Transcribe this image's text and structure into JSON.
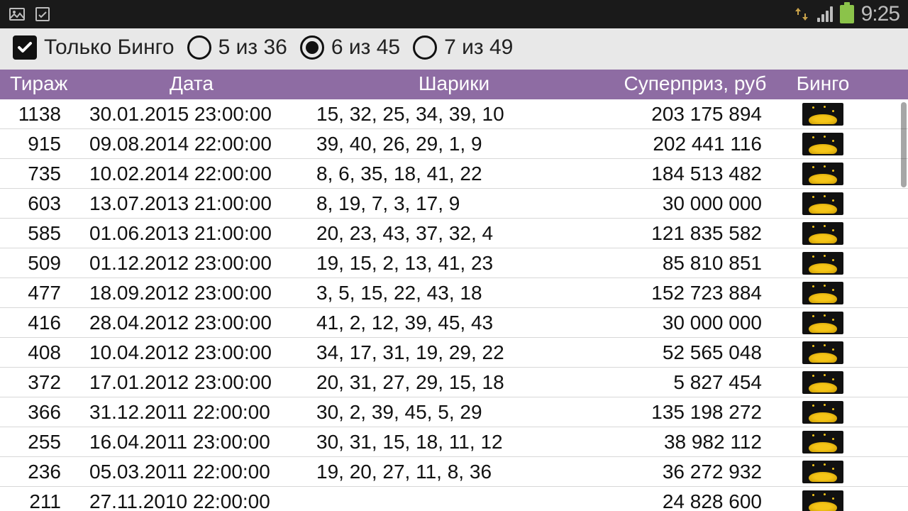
{
  "statusbar": {
    "clock": "9:25"
  },
  "filter": {
    "bingo_only_label": "Только Бинго",
    "bingo_only_checked": true,
    "options": [
      {
        "label": "5 из 36",
        "selected": false
      },
      {
        "label": "6 из 45",
        "selected": true
      },
      {
        "label": "7 из 49",
        "selected": false
      }
    ]
  },
  "table": {
    "headers": {
      "draw": "Тираж",
      "date": "Дата",
      "balls": "Шарики",
      "prize": "Суперприз, руб",
      "bingo": "Бинго"
    },
    "rows": [
      {
        "draw": "1138",
        "date": "30.01.2015 23:00:00",
        "balls": "15, 32, 25, 34, 39, 10",
        "prize": "203 175 894"
      },
      {
        "draw": "915",
        "date": "09.08.2014 22:00:00",
        "balls": "39, 40, 26, 29, 1, 9",
        "prize": "202 441 116"
      },
      {
        "draw": "735",
        "date": "10.02.2014 22:00:00",
        "balls": "8, 6, 35, 18, 41, 22",
        "prize": "184 513 482"
      },
      {
        "draw": "603",
        "date": "13.07.2013 21:00:00",
        "balls": "8, 19, 7, 3, 17, 9",
        "prize": "30 000 000"
      },
      {
        "draw": "585",
        "date": "01.06.2013 21:00:00",
        "balls": "20, 23, 43, 37, 32, 4",
        "prize": "121 835 582"
      },
      {
        "draw": "509",
        "date": "01.12.2012 23:00:00",
        "balls": "19, 15, 2, 13, 41, 23",
        "prize": "85 810 851"
      },
      {
        "draw": "477",
        "date": "18.09.2012 23:00:00",
        "balls": "3, 5, 15, 22, 43, 18",
        "prize": "152 723 884"
      },
      {
        "draw": "416",
        "date": "28.04.2012 23:00:00",
        "balls": "41, 2, 12, 39, 45, 43",
        "prize": "30 000 000"
      },
      {
        "draw": "408",
        "date": "10.04.2012 23:00:00",
        "balls": "34, 17, 31, 19, 29, 22",
        "prize": "52 565 048"
      },
      {
        "draw": "372",
        "date": "17.01.2012 23:00:00",
        "balls": "20, 31, 27, 29, 15, 18",
        "prize": "5 827 454"
      },
      {
        "draw": "366",
        "date": "31.12.2011 22:00:00",
        "balls": "30, 2, 39, 45, 5, 29",
        "prize": "135 198 272"
      },
      {
        "draw": "255",
        "date": "16.04.2011 23:00:00",
        "balls": "30, 31, 15, 18, 11, 12",
        "prize": "38 982 112"
      },
      {
        "draw": "236",
        "date": "05.03.2011 22:00:00",
        "balls": "19, 20, 27, 11, 8, 36",
        "prize": "36 272 932"
      },
      {
        "draw": "211",
        "date": "27.11.2010 22:00:00",
        "balls": "",
        "prize": "24 828 600"
      }
    ]
  }
}
